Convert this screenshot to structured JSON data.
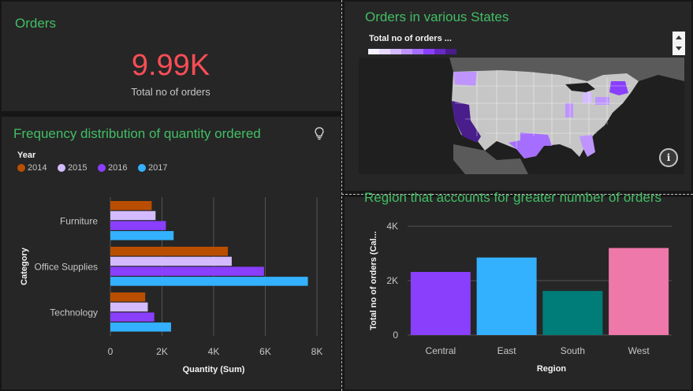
{
  "kpi": {
    "title": "Orders",
    "value": "9.99K",
    "label": "Total no of orders"
  },
  "freq_chart": {
    "title": "Frequency distribution of quantity ordered",
    "legend_title": "Year",
    "icon": "lightbulb-icon"
  },
  "map": {
    "title": "Orders in various States",
    "legend_title": "Total no of orders ...",
    "legend_colors": [
      "#f6f2ff",
      "#e8daff",
      "#d4bbff",
      "#be95ff",
      "#a56eff",
      "#8a3ffc",
      "#6929c4",
      "#491d8b"
    ],
    "info_icon": "i",
    "scroll_up_icon": "scroll-up-icon",
    "scroll_down_icon": "scroll-down-icon"
  },
  "region_chart": {
    "title": "Region that accounts for greater number of orders"
  },
  "chart_data": [
    {
      "type": "bar",
      "orientation": "horizontal",
      "categories": [
        "Furniture",
        "Office Supplies",
        "Technology"
      ],
      "series": [
        {
          "name": "2014",
          "color": "#ba4e00",
          "values": [
            1600,
            4550,
            1350
          ]
        },
        {
          "name": "2015",
          "color": "#d4bbff",
          "values": [
            1750,
            4700,
            1450
          ]
        },
        {
          "name": "2016",
          "color": "#8a3ffc",
          "values": [
            2150,
            5950,
            1700
          ]
        },
        {
          "name": "2017",
          "color": "#33b1ff",
          "values": [
            2450,
            7650,
            2350
          ]
        }
      ],
      "xlabel": "Quantity (Sum)",
      "ylabel": "Category",
      "xlim": [
        0,
        8000
      ],
      "xticks": [
        "0",
        "2K",
        "4K",
        "6K",
        "8K"
      ],
      "xtick_values": [
        0,
        2000,
        4000,
        6000,
        8000
      ],
      "grid": true,
      "legend": "top-left"
    },
    {
      "type": "bar",
      "categories": [
        "Central",
        "East",
        "South",
        "West"
      ],
      "values": [
        2320,
        2850,
        1620,
        3200
      ],
      "colors": [
        "#8a3ffc",
        "#33b1ff",
        "#007d79",
        "#ee78aa"
      ],
      "xlabel": "Region",
      "ylabel": "Total no of orders (Cal...",
      "ylim": [
        0,
        4000
      ],
      "yticks": [
        "0",
        "2K",
        "4K"
      ],
      "ytick_values": [
        0,
        2000,
        4000
      ],
      "grid": true
    }
  ]
}
